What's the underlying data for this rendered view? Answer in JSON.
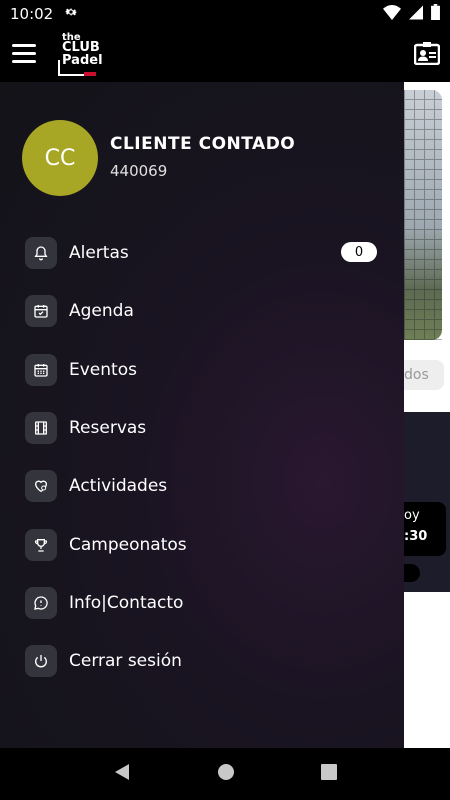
{
  "status_bar": {
    "time": "10:02"
  },
  "brand": {
    "logo_l1": "the",
    "logo_l2": "CLUB",
    "logo_l3": "Padel"
  },
  "user": {
    "initials": "CC",
    "name": "CLIENTE CONTADO",
    "id": "440069",
    "avatar_color": "#a8a625"
  },
  "menu": [
    {
      "label": "Alertas",
      "icon": "bell-icon",
      "badge": "0"
    },
    {
      "label": "Agenda",
      "icon": "calendar-check-icon"
    },
    {
      "label": "Eventos",
      "icon": "calendar-grid-icon"
    },
    {
      "label": "Reservas",
      "icon": "film-grid-icon"
    },
    {
      "label": "Actividades",
      "icon": "heart-icon"
    },
    {
      "label": "Campeonatos",
      "icon": "trophy-icon"
    },
    {
      "label": "Info|Contacto",
      "icon": "chat-icon"
    },
    {
      "label": "Cerrar sesión",
      "icon": "power-icon"
    }
  ],
  "background": {
    "chip_text": "dos",
    "pill_line1": "oy",
    "pill_line2": ":30"
  },
  "colors": {
    "drawer_bg": "#131318",
    "icon_bg": "#34343c",
    "badge_bg": "#ffffff"
  }
}
